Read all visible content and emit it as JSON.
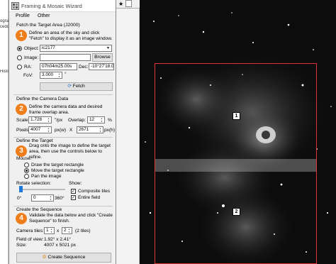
{
  "wizard": {
    "title": "Framing & Mosaic Wizard",
    "menu": [
      "Profile",
      "Other"
    ]
  },
  "left_strip": {
    "texts": [
      "ograp",
      "cedd",
      "Histo"
    ]
  },
  "step1": {
    "header": "Fetch the Target Area (J2000)",
    "number": "1",
    "desc": "Define an area of the sky and click \"Fetch\" to display it as an image window.",
    "object_label": "Object:",
    "object_value": "ic2177",
    "image_label": "Image:",
    "browse_label": "Browse",
    "ra_label": "RA:",
    "ra_value": "07h04m25.00s",
    "dec_label": "Dec:",
    "dec_value": "-10°27'18.00\"",
    "fov_label": "FoV:",
    "fov_value": "3.000",
    "fov_unit": "°",
    "fetch_label": "Fetch"
  },
  "step2": {
    "header": "Define the Camera Data",
    "number": "2",
    "desc": "Define the camera data and desired frame overlap area.",
    "scale_label": "Scale:",
    "scale_value": "1.728",
    "scale_unit": "\"/px",
    "overlap_label": "Overlap:",
    "overlap_value": "12",
    "overlap_unit": "%",
    "pixels_label": "Pixels:",
    "pixels_w": "4007",
    "pixels_w_unit": "px(w)",
    "pixels_x": "X",
    "pixels_h": "2671",
    "pixels_h_unit": "px(h)"
  },
  "step3": {
    "header": "Define the Target",
    "number": "3",
    "desc": "Drag onto the image to define the target area, then use the controls below to refine.",
    "mouse_label": "Mouse:",
    "mouse_options": [
      "Draw the target rectangle",
      "Move the target rectangle",
      "Pan the image"
    ],
    "mouse_selected": 1,
    "rotate_label": "Rotate selection:",
    "rotate_min": "0°",
    "rotate_value": "0",
    "rotate_max": "360°",
    "show_label": "Show:",
    "show_options": [
      "Composite tiles",
      "Entire field"
    ],
    "show_checked": [
      true,
      true
    ]
  },
  "step4": {
    "header": "Create the Sequence",
    "number": "4",
    "desc": "Validate the data below and click \"Create Sequence\" to finish.",
    "camera_tiles_label": "Camera tiles:",
    "tiles_x": "1",
    "tiles_times": "x",
    "tiles_y": "2",
    "tiles_count": "(2 tiles)",
    "fov_label": "Field of view:",
    "fov_value": "1.92° x 2.41°",
    "size_label": "Size:",
    "size_value": "4007 x 5021 px",
    "create_label": "Create Sequence"
  },
  "sky": {
    "tile_labels": [
      "1",
      "2"
    ]
  },
  "colors": {
    "step_accent": "#ef7d1a",
    "target_rect": "#dd3333",
    "slider_thumb": "#1e78d7"
  }
}
